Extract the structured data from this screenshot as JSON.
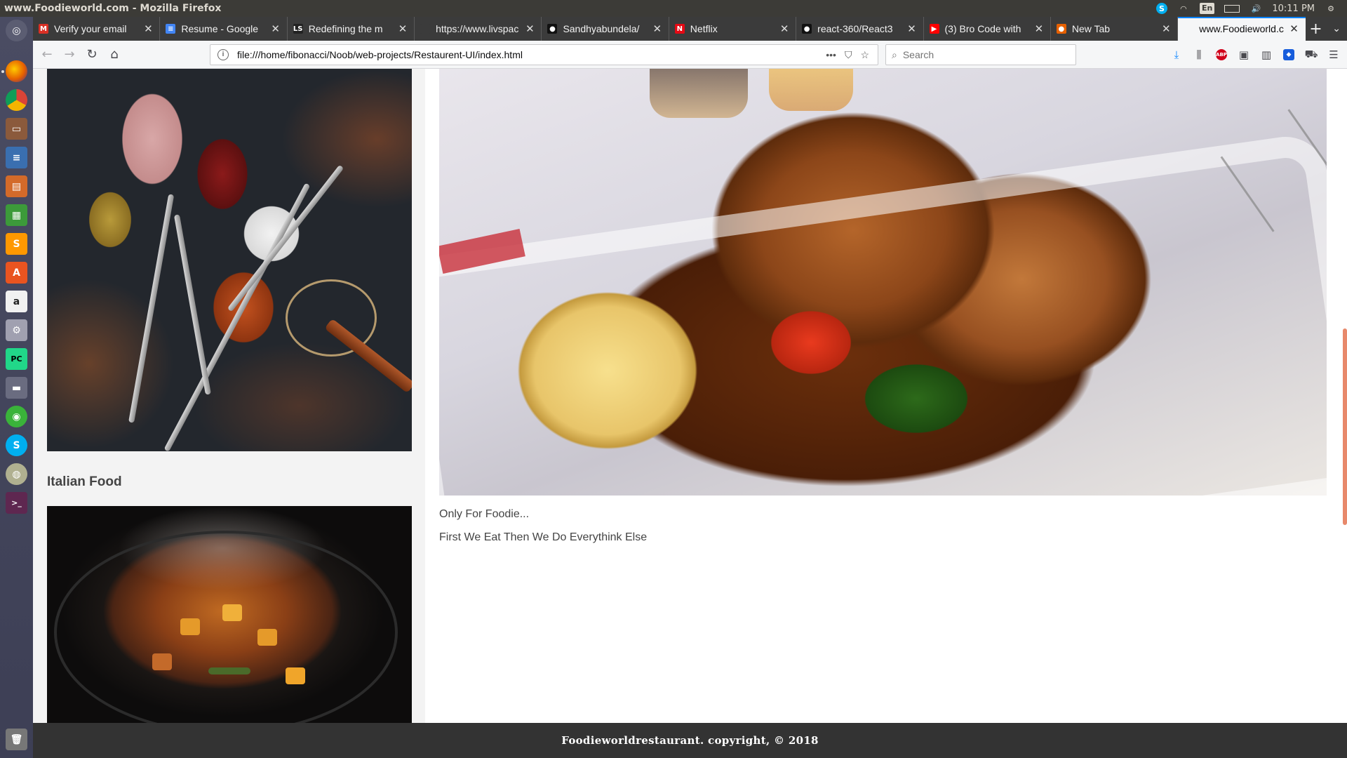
{
  "system": {
    "window_title": "www.Foodieworld.com - Mozilla Firefox",
    "keyboard_layout": "En",
    "clock": "10:11 PM"
  },
  "browser": {
    "tabs": [
      {
        "label": "Verify your email",
        "favicon": "gmail-icon",
        "color": "#d93025",
        "glyph": "M"
      },
      {
        "label": "Resume - Google",
        "favicon": "google-docs-icon",
        "color": "#4285f4",
        "glyph": "≡"
      },
      {
        "label": "Redefining the m",
        "favicon": "ls-icon",
        "color": "#222222",
        "glyph": "LS"
      },
      {
        "label": "https://www.livspac",
        "favicon": "blank-page-icon",
        "color": "#3b3b3b",
        "glyph": ""
      },
      {
        "label": "Sandhyabundela/",
        "favicon": "github-icon",
        "color": "#111111",
        "glyph": "●"
      },
      {
        "label": "Netflix",
        "favicon": "netflix-icon",
        "color": "#e50914",
        "glyph": "N"
      },
      {
        "label": "react-360/React3",
        "favicon": "github-icon",
        "color": "#111111",
        "glyph": "●"
      },
      {
        "label": "(3) Bro Code with",
        "favicon": "youtube-icon",
        "color": "#ff0000",
        "glyph": "▶"
      },
      {
        "label": "New Tab",
        "favicon": "firefox-icon",
        "color": "#e66000",
        "glyph": "●"
      },
      {
        "label": "www.Foodieworld.c",
        "favicon": "blank-page-icon",
        "color": "#f5f6f7",
        "glyph": "",
        "active": true
      }
    ],
    "url": "file:///home/fibonacci/Noob/web-projects/Restaurent-UI/index.html",
    "search_placeholder": "Search"
  },
  "page": {
    "italian_heading": "Italian Food",
    "tagline_1": "Only For Foodie...",
    "tagline_2": "First We Eat Then We Do Everythink Else",
    "footer": "Foodieworldrestaurant. copyright, © 2018"
  }
}
